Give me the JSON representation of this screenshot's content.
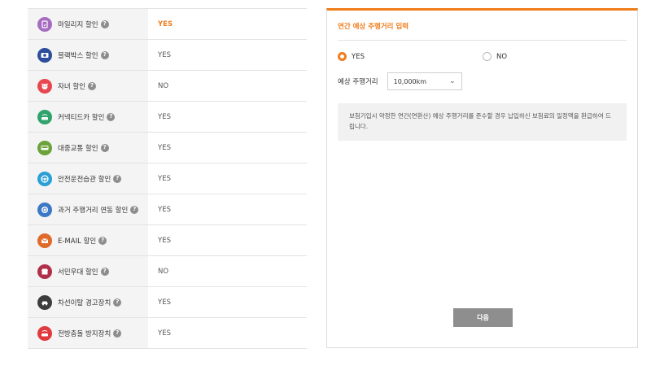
{
  "discounts": [
    {
      "icon": "mileage-icon",
      "color": "#a56cc1",
      "label": "마일리지 할인",
      "value": "YES",
      "highlight": true
    },
    {
      "icon": "blackbox-icon",
      "color": "#2d4e9c",
      "label": "블랙박스 할인",
      "value": "YES",
      "highlight": false
    },
    {
      "icon": "child-icon",
      "color": "#e8474f",
      "label": "자녀 할인",
      "value": "NO",
      "highlight": false
    },
    {
      "icon": "connected-car-icon",
      "color": "#2fa36b",
      "label": "커넥티드카 할인",
      "value": "YES",
      "highlight": false
    },
    {
      "icon": "bus-icon",
      "color": "#6ba23a",
      "label": "대중교통 할인",
      "value": "YES",
      "highlight": false
    },
    {
      "icon": "steering-wheel-icon",
      "color": "#2a9fd6",
      "label": "안전운전습관 할인",
      "value": "YES",
      "highlight": false
    },
    {
      "icon": "odometer-icon",
      "color": "#3d78c6",
      "label": "과거 주행거리 연동 할인",
      "value": "YES",
      "highlight": false
    },
    {
      "icon": "email-icon",
      "color": "#e06a2a",
      "label": "E-MAIL 할인",
      "value": "YES",
      "highlight": false
    },
    {
      "icon": "shop-icon",
      "color": "#b0304a",
      "label": "서민우대 할인",
      "value": "NO",
      "highlight": false
    },
    {
      "icon": "lane-warning-icon",
      "color": "#3d3d3d",
      "label": "차선이탈 경고장치",
      "value": "YES",
      "highlight": false
    },
    {
      "icon": "collision-icon",
      "color": "#e03a3e",
      "label": "전방충돌 방지장치",
      "value": "YES",
      "highlight": false
    }
  ],
  "help_glyph": "?",
  "panel": {
    "title": "연간 예상 주행거리 입력",
    "yes_label": "YES",
    "no_label": "NO",
    "selected": "YES",
    "distance_label": "예상 주행거리",
    "distance_value": "10,000km",
    "notice": "보험기입시 약정한 연간(연환산) 예상 주행거리를 준수할 경우 납입하신 보험료의 일정액을 환급하여 드립니다.",
    "next_label": "다음"
  },
  "colors": {
    "accent": "#f07d1c",
    "button": "#8e8e8e"
  }
}
